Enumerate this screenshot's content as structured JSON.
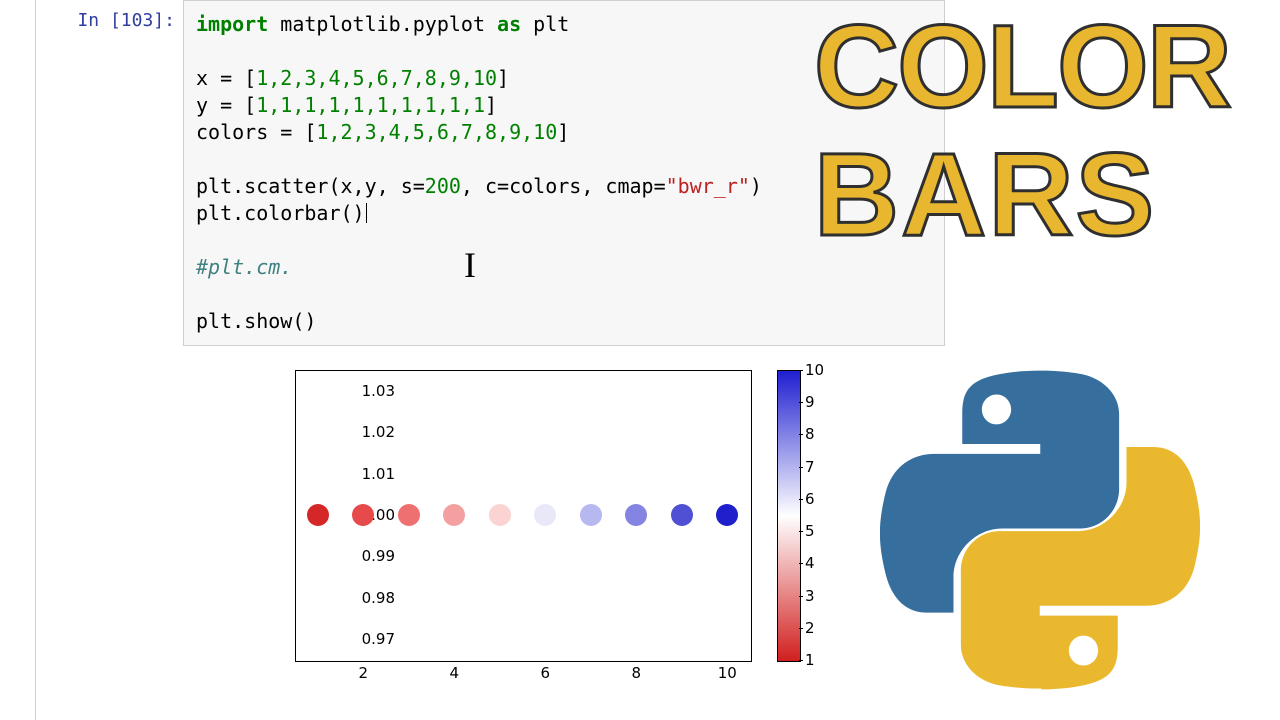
{
  "cell": {
    "prompt": "In [103]:",
    "code": {
      "l1_import": "import",
      "l1_mod": " matplotlib.pyplot ",
      "l1_as": "as",
      "l1_alias": " plt",
      "l3_pre": "x = [",
      "l3_nums": "1,2,3,4,5,6,7,8,9,10",
      "l3_post": "]",
      "l4_pre": "y = [",
      "l4_nums": "1,1,1,1,1,1,1,1,1,1",
      "l4_post": "]",
      "l5_pre": "colors = [",
      "l5_nums": "1,2,3,4,5,6,7,8,9,10",
      "l5_post": "]",
      "l7_pre": "plt.scatter(x,y, s=",
      "l7_s": "200",
      "l7_mid": ", c=colors, cmap=",
      "l7_str": "\"bwr_r\"",
      "l7_post": ")",
      "l8": "plt.colorbar()",
      "l10_comment": "#plt.cm.",
      "l12": "plt.show()"
    }
  },
  "overlay": {
    "line1": "COLOR",
    "line2": "BARS"
  },
  "chart_data": {
    "type": "scatter",
    "x": [
      1,
      2,
      3,
      4,
      5,
      6,
      7,
      8,
      9,
      10
    ],
    "y": [
      1,
      1,
      1,
      1,
      1,
      1,
      1,
      1,
      1,
      1
    ],
    "c": [
      1,
      2,
      3,
      4,
      5,
      6,
      7,
      8,
      9,
      10
    ],
    "cmap": "bwr_r",
    "xlim": [
      0.5,
      10.5
    ],
    "ylim": [
      0.965,
      1.035
    ],
    "xticks": [
      2,
      4,
      6,
      8,
      10
    ],
    "yticks": [
      0.97,
      0.98,
      0.99,
      1.0,
      1.01,
      1.02,
      1.03
    ],
    "ytick_labels": [
      "0.97",
      "0.98",
      "0.99",
      "1.00",
      "1.01",
      "1.02",
      "1.03"
    ],
    "colorbar_ticks": [
      1,
      2,
      3,
      4,
      5,
      6,
      7,
      8,
      9,
      10
    ],
    "colorbar_range": [
      1,
      10
    ],
    "point_colors": [
      "#d62728",
      "#e74a4a",
      "#ef7070",
      "#f5a0a0",
      "#fbd3d3",
      "#e8e8f9",
      "#b8b8f0",
      "#8484e2",
      "#5050d4",
      "#1f1fcc"
    ]
  }
}
